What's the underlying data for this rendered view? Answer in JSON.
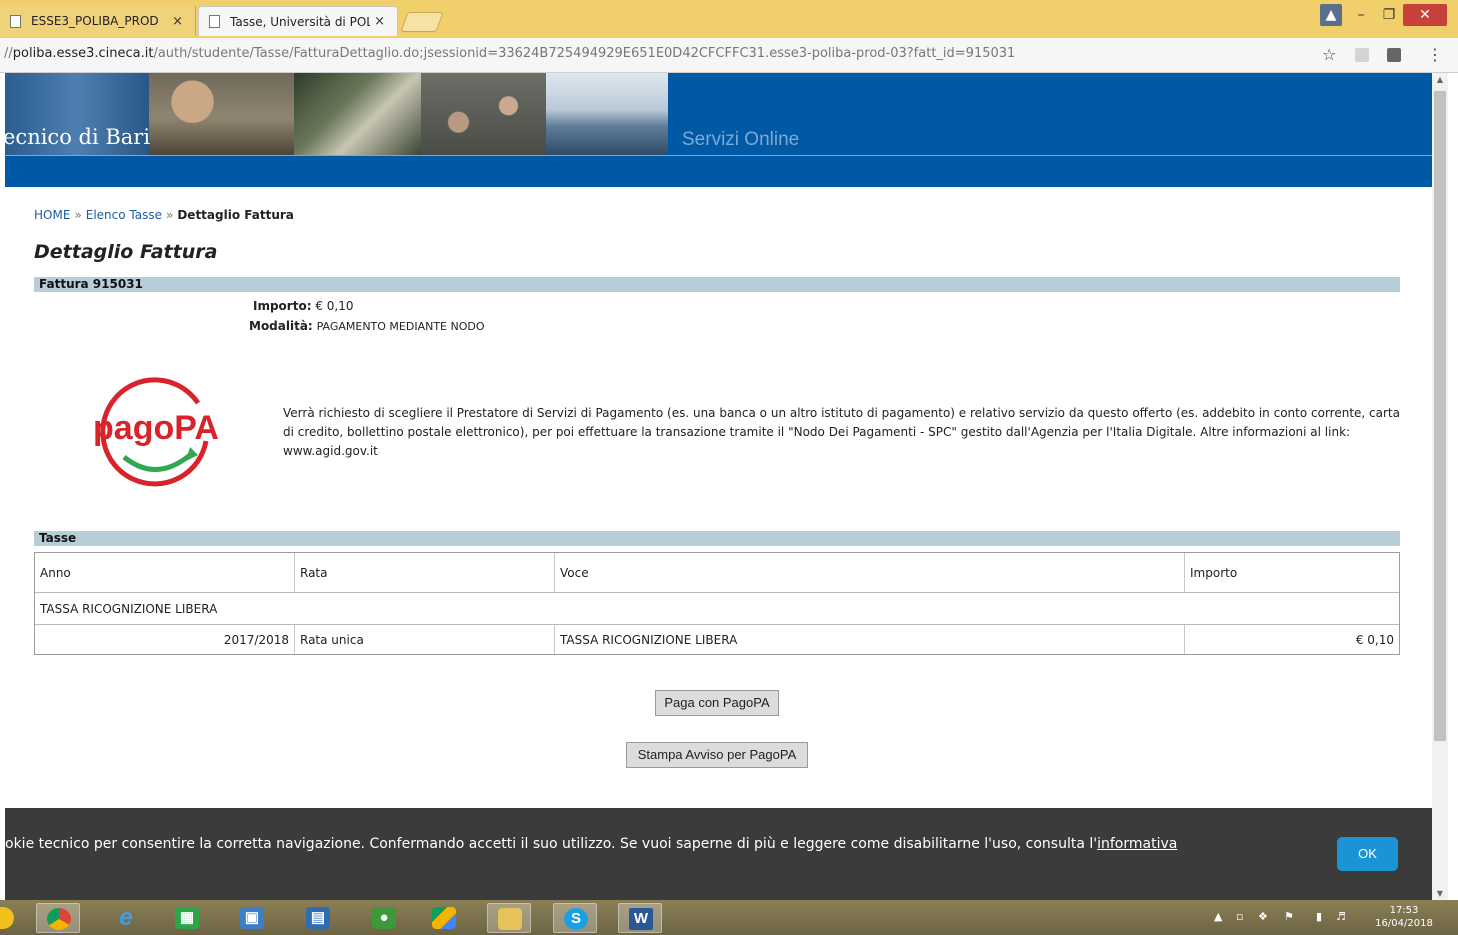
{
  "browser": {
    "tabs": [
      {
        "label": "ESSE3_POLIBA_PROD",
        "close": "×"
      },
      {
        "label": "Tasse, Università di POLI",
        "close": "×"
      }
    ],
    "url_prefix": "//",
    "url_host": "poliba.esse3.cineca.it",
    "url_path": "/auth/studente/Tasse/FatturaDettaglio.do;jsessionid=33624B725494929E651E0D42CFCFFC31.esse3-poliba-prod-03?fatt_id=915031",
    "window_controls": {
      "minimize": "–",
      "maximize": "❐",
      "close": "✕"
    },
    "icons": {
      "bookmark": "☆",
      "menu": "⋮"
    }
  },
  "header": {
    "university": "ecnico di Bari",
    "servizi": "Servizi Online"
  },
  "breadcrumb": {
    "home": "HOME",
    "sep": "»",
    "elenco": "Elenco Tasse",
    "current": "Dettaglio Fattura"
  },
  "page_title": "Dettaglio Fattura",
  "fattura": {
    "heading": "Fattura 915031",
    "importo_label": "Importo:",
    "importo_value": "€ 0,10",
    "modalita_label": "Modalità:",
    "modalita_value": "PAGAMENTO MEDIANTE NODO"
  },
  "pagopa": {
    "logo_text": "pagoPA",
    "description": "Verrà richiesto di scegliere il Prestatore di Servizi di Pagamento (es. una banca o un altro istituto di pagamento) e relativo servizio da questo offerto (es. addebito in conto corrente, carta di credito, bollettino postale elettronico), per poi effettuare la transazione tramite il \"Nodo Dei Pagamenti - SPC\" gestito dall'Agenzia per l'Italia Digitale. Altre informazioni al link: www.agid.gov.it"
  },
  "tasse": {
    "heading": "Tasse",
    "columns": [
      "Anno",
      "Rata",
      "Voce",
      "Importo"
    ],
    "group": "TASSA RICOGNIZIONE LIBERA",
    "rows": [
      {
        "anno": "2017/2018",
        "rata": "Rata unica",
        "voce": "TASSA RICOGNIZIONE LIBERA",
        "importo": "€ 0,10"
      }
    ]
  },
  "buttons": {
    "paga": "Paga con PagoPA",
    "stampa": "Stampa Avviso per PagoPA"
  },
  "cookie": {
    "text": "okie tecnico per consentire la corretta navigazione. Confermando accetti il suo utilizzo. Se vuoi saperne di più e leggere come disabilitarne l'uso, consulta l'",
    "link": "informativa",
    "ok": "OK"
  },
  "taskbar": {
    "apps": [
      "chrome-icon",
      "internet-explorer-icon",
      "store-icon",
      "remote-desktop-icon",
      "file-manager-icon",
      "evernote-icon",
      "google-drive-icon",
      "file-explorer-icon",
      "skype-icon",
      "word-icon"
    ],
    "time": "17:53",
    "date": "16/04/2018"
  },
  "colors": {
    "banner": "#0059a4",
    "section_bar": "#b7ced8",
    "cookie_bg": "#3b3b3b",
    "ok_button": "#1b94d6",
    "pagopa_red": "#d8232a",
    "pagopa_green": "#2fa84f"
  }
}
